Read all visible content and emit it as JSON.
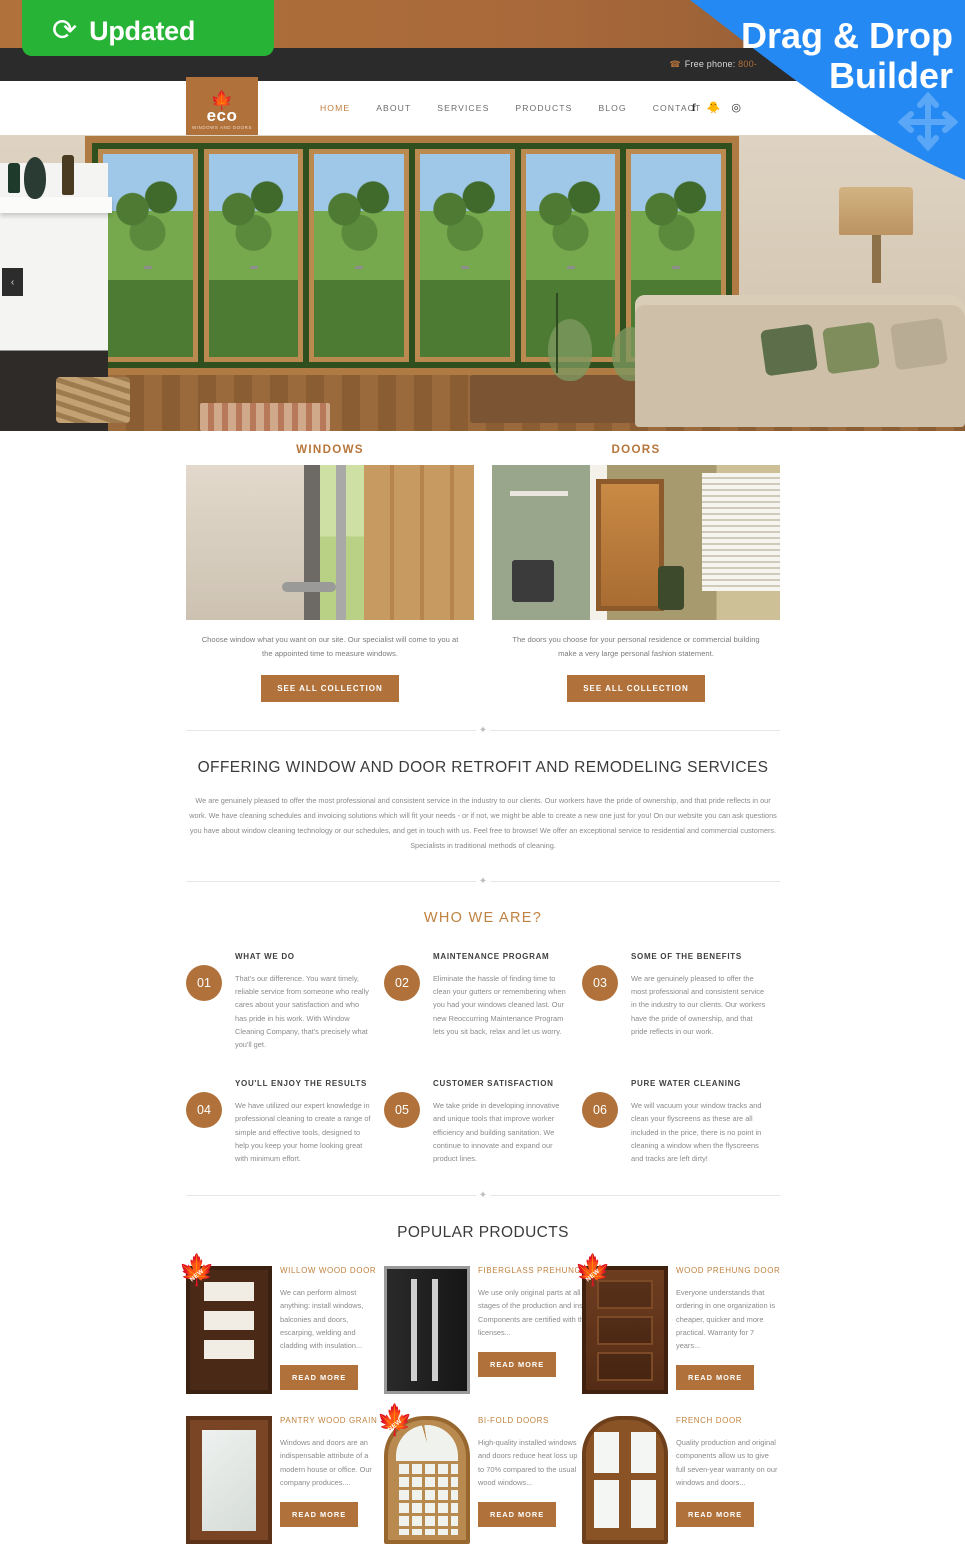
{
  "overlays": {
    "updated_label": "Updated",
    "updated_icon": "refresh-icon",
    "updated_color": "#27b436",
    "ribbon_line1": "Drag & Drop",
    "ribbon_line2": "Builder",
    "ribbon_color": "#2489f2",
    "ribbon_icon": "four-way-arrow-icon"
  },
  "topbar": {
    "phone_label": "Free phone:",
    "phone_number": "800-",
    "phone_icon": "phone-icon"
  },
  "brand": {
    "leaf_icon": "maple-leaf-icon",
    "name": "eco",
    "tagline": "WINDOWS AND DOORS",
    "accent": "#b0713a"
  },
  "nav": {
    "items": [
      {
        "label": "HOME",
        "active": true
      },
      {
        "label": "ABOUT",
        "active": false
      },
      {
        "label": "SERVICES",
        "active": false
      },
      {
        "label": "PRODUCTS",
        "active": false
      },
      {
        "label": "BLOG",
        "active": false
      },
      {
        "label": "CONTACT",
        "active": false
      }
    ],
    "social": [
      {
        "icon": "facebook-icon",
        "glyph": "f"
      },
      {
        "icon": "twitter-icon",
        "glyph": "ᵛ"
      },
      {
        "icon": "instagram-icon",
        "glyph": "◎"
      }
    ]
  },
  "hero": {
    "prev_icon": "chevron-left-icon",
    "prev_label": "‹"
  },
  "promos": [
    {
      "title": "WINDOWS",
      "text": "Choose window what you want on our site. Our specialist will come to you at the appointed time to measure windows.",
      "button": "SEE ALL COLLECTION",
      "image": "window-interior-photo"
    },
    {
      "title": "DOORS",
      "text": "The doors you choose for your personal residence or commercial building make a very large personal fashion statement.",
      "button": "SEE ALL COLLECTION",
      "image": "wood-door-room-photo"
    }
  ],
  "offering": {
    "ornament": "maple-diamond-ornament",
    "title": "OFFERING WINDOW AND DOOR RETROFIT AND REMODELING SERVICES",
    "body": "We are genuinely pleased to offer the most professional and consistent service in the industry to our clients. Our workers have the pride of ownership, and that pride reflects in our work. We have cleaning schedules and invoicing solutions which will fit your needs - or if not, we might be able to create a new one just for you! On our website you can ask questions you have about window cleaning technology or our schedules, and get in touch with us. Feel free to browse! We offer an exceptional service to residential and commercial customers. Specialists in traditional methods of cleaning."
  },
  "who_we_are": {
    "title": "WHO WE ARE?",
    "features": [
      {
        "num": "01",
        "title": "WHAT WE DO",
        "text": "That's our difference. You want timely, reliable service from someone who really cares about your satisfaction and who has pride in his work. With Window Cleaning Company, that's precisely what you'll get."
      },
      {
        "num": "02",
        "title": "MAINTENANCE PROGRAM",
        "text": "Eliminate the hassle of finding time to clean your gutters or remembering when you had your windows cleaned last. Our new Reoccurring Maintenance Program lets you sit back, relax and let us worry."
      },
      {
        "num": "03",
        "title": "SOME OF THE BENEFITS",
        "text": "We are genuinely pleased to offer the most professional and consistent service in the industry to our clients. Our workers have the pride of ownership, and that pride reflects in our work."
      },
      {
        "num": "04",
        "title": "YOU'LL ENJOY THE RESULTS",
        "text": "We have utilized our expert knowledge in professional cleaning to create a range of simple and effective tools, designed to help you keep your home looking great with minimum effort."
      },
      {
        "num": "05",
        "title": "CUSTOMER SATISFACTION",
        "text": "We take pride in developing innovative and unique tools that improve worker efficiency and building sanitation. We continue to innovate and expand our product lines."
      },
      {
        "num": "06",
        "title": "PURE WATER CLEANING",
        "text": "We will vacuum your window tracks and clean your flyscreens as these are all included in the price, there is no point in cleaning a window when the flyscreens and tracks are left dirty!"
      }
    ]
  },
  "products": {
    "title": "POPULAR PRODUCTS",
    "read_more": "READ MORE",
    "new_badge": "NEW",
    "items": [
      {
        "name": "WILLOW WOOD DOOR",
        "text": "We can perform almost anything: install windows, balconies and doors, escarping, welding and cladding with insulation...",
        "is_new": true,
        "art": "d-dark-panel"
      },
      {
        "name": "FIBERGLASS PREHUNG DOOR",
        "text": "We use only original parts at all the stages of the production and installation. Components are certified with the licenses...",
        "is_new": false,
        "art": "d-black"
      },
      {
        "name": "WOOD PREHUNG DOOR",
        "text": "Everyone understands that ordering in one organization is cheaper, quicker and more practical. Warranty for 7 years...",
        "is_new": true,
        "art": "d-brown"
      },
      {
        "name": "PANTRY WOOD GRAIN",
        "text": "Windows and doors are an indispensable attribute of a modern house or office. Our company produces....",
        "is_new": false,
        "art": "d-glasswood"
      },
      {
        "name": "BI-FOLD DOORS",
        "text": "High-quality installed windows and doors reduce heat loss up to 70% compared to the usual wood windows...",
        "is_new": true,
        "art": "d-arch"
      },
      {
        "name": "FRENCH DOOR",
        "text": " Quality production and original components allow us to give full seven-year warranty on our windows and doors...",
        "is_new": false,
        "art": "d-bifold"
      }
    ]
  }
}
